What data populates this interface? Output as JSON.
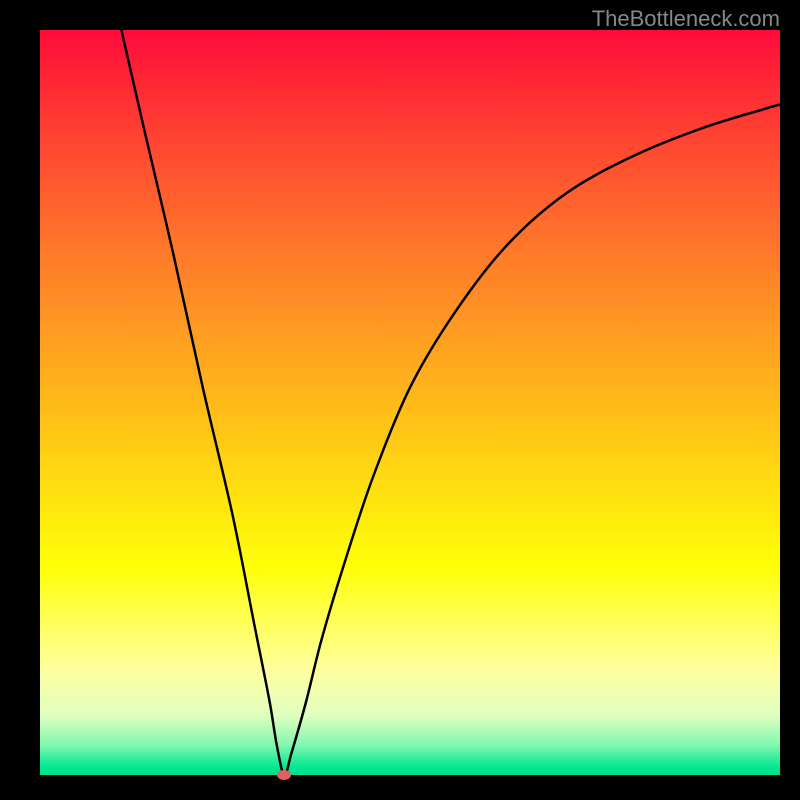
{
  "watermark": "TheBottleneck.com",
  "chart_data": {
    "type": "line",
    "title": "",
    "xlabel": "",
    "ylabel": "",
    "xlim": [
      0,
      100
    ],
    "ylim": [
      0,
      100
    ],
    "grid": false,
    "legend": false,
    "marker": {
      "x": 33,
      "y": 0,
      "color": "#e16060"
    },
    "gradient_stops": [
      {
        "pos": 0.0,
        "color": "#ff0b3b"
      },
      {
        "pos": 0.5,
        "color": "#ffc018"
      },
      {
        "pos": 0.72,
        "color": "#ffff08"
      },
      {
        "pos": 1.0,
        "color": "#00e088"
      }
    ],
    "curve": [
      {
        "x": 11,
        "y": 100
      },
      {
        "x": 14,
        "y": 87
      },
      {
        "x": 18,
        "y": 70
      },
      {
        "x": 22,
        "y": 52
      },
      {
        "x": 26,
        "y": 35
      },
      {
        "x": 29,
        "y": 20
      },
      {
        "x": 31,
        "y": 10
      },
      {
        "x": 32,
        "y": 4
      },
      {
        "x": 33,
        "y": 0
      },
      {
        "x": 34,
        "y": 3
      },
      {
        "x": 36,
        "y": 10
      },
      {
        "x": 38,
        "y": 18
      },
      {
        "x": 41,
        "y": 28
      },
      {
        "x": 45,
        "y": 40
      },
      {
        "x": 50,
        "y": 52
      },
      {
        "x": 56,
        "y": 62
      },
      {
        "x": 63,
        "y": 71
      },
      {
        "x": 71,
        "y": 78
      },
      {
        "x": 80,
        "y": 83
      },
      {
        "x": 90,
        "y": 87
      },
      {
        "x": 100,
        "y": 90
      }
    ]
  }
}
